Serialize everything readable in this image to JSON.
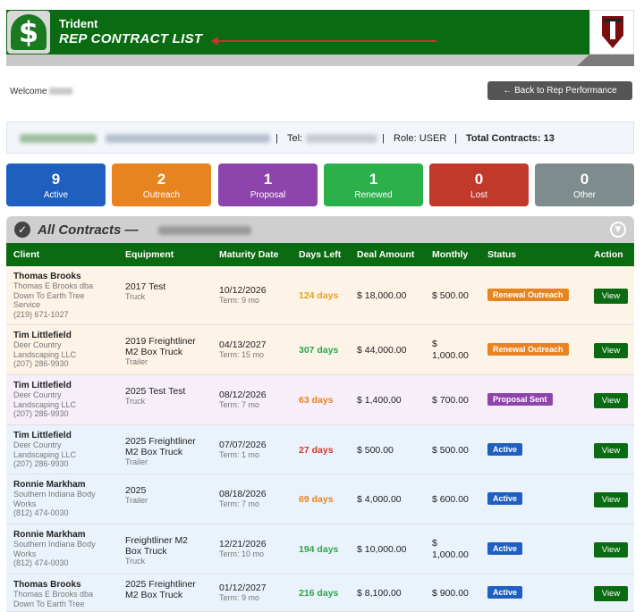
{
  "header": {
    "brand": "Trident",
    "title": "REP CONTRACT LIST"
  },
  "welcome_label": "Welcome",
  "back_button_label": "← Back to Rep Performance",
  "info": {
    "tel_label": "Tel:",
    "sep1": "|",
    "sep2": "|",
    "sep3": "|",
    "role": "Role: USER",
    "total_label": "Total Contracts: 13"
  },
  "stats": [
    {
      "count": "9",
      "label": "Active",
      "color": "#1f5fbf"
    },
    {
      "count": "2",
      "label": "Outreach",
      "color": "#e8841f"
    },
    {
      "count": "1",
      "label": "Proposal",
      "color": "#8e44ad"
    },
    {
      "count": "1",
      "label": "Renewed",
      "color": "#2bb04a"
    },
    {
      "count": "0",
      "label": "Lost",
      "color": "#c0392b"
    },
    {
      "count": "0",
      "label": "Other",
      "color": "#7f8c8d"
    }
  ],
  "section_title": "All Contracts —",
  "columns": [
    "Client",
    "Equipment",
    "Maturity Date",
    "Days Left",
    "Deal Amount",
    "Monthly",
    "Status",
    "Action"
  ],
  "rows": [
    {
      "name": "Thomas Brooks",
      "company1": "Thomas E Brooks dba",
      "company2": "Down To Earth Tree",
      "company3": "Service",
      "phone": "(219) 671-1027",
      "eq1": "2017 Test",
      "eq2": "",
      "eqtype": "Truck",
      "date": "10/12/2026",
      "term": "Term: 9 mo",
      "days": "124 days",
      "days_color": "#e8a11f",
      "amount": "$ 18,000.00",
      "monthly1": "$ 500.00",
      "monthly2": "",
      "status": "Renewal Outreach",
      "status_color": "#e8841f",
      "action": "View",
      "bg": "#fdf3e6"
    },
    {
      "name": "Tim Littlefield",
      "company1": "Deer Country",
      "company2": "Landscaping LLC",
      "company3": "",
      "phone": "(207) 286-9930",
      "eq1": "2019 Freightliner",
      "eq2": "M2 Box Truck",
      "eqtype": "Trailer",
      "date": "04/13/2027",
      "term": "Term: 15 mo",
      "days": "307 days",
      "days_color": "#2aa84a",
      "amount": "$ 44,000.00",
      "monthly1": "$",
      "monthly2": "1,000.00",
      "status": "Renewal Outreach",
      "status_color": "#e8841f",
      "action": "View",
      "bg": "#fdf3e6"
    },
    {
      "name": "Tim Littlefield",
      "company1": "Deer Country",
      "company2": "Landscaping LLC",
      "company3": "",
      "phone": "(207) 286-9930",
      "eq1": "2025 Test Test",
      "eq2": "",
      "eqtype": "Truck",
      "date": "08/12/2026",
      "term": "Term: 7 mo",
      "days": "63 days",
      "days_color": "#e8841f",
      "amount": "$ 1,400.00",
      "monthly1": "$ 700.00",
      "monthly2": "",
      "status": "Proposal Sent",
      "status_color": "#8e44ad",
      "action": "View",
      "bg": "#f6eef8"
    },
    {
      "name": "Tim Littlefield",
      "company1": "Deer Country",
      "company2": "Landscaping LLC",
      "company3": "",
      "phone": "(207) 286-9930",
      "eq1": "2025 Freightliner",
      "eq2": "M2 Box Truck",
      "eqtype": "Trailer",
      "date": "07/07/2026",
      "term": "Term: 1 mo",
      "days": "27 days",
      "days_color": "#d0392b",
      "amount": "$ 500.00",
      "monthly1": "$ 500.00",
      "monthly2": "",
      "status": "Active",
      "status_color": "#1f5fbf",
      "action": "View",
      "bg": "#eaf3fb"
    },
    {
      "name": "Ronnie Markham",
      "company1": "Southern Indiana Body",
      "company2": "Works",
      "company3": "",
      "phone": "(812) 474-0030",
      "eq1": "2025",
      "eq2": "",
      "eqtype": "Trailer",
      "date": "08/18/2026",
      "term": "Term: 7 mo",
      "days": "69 days",
      "days_color": "#e8841f",
      "amount": "$ 4,000.00",
      "monthly1": "$ 600.00",
      "monthly2": "",
      "status": "Active",
      "status_color": "#1f5fbf",
      "action": "View",
      "bg": "#eaf3fb"
    },
    {
      "name": "Ronnie Markham",
      "company1": "Southern Indiana Body",
      "company2": "Works",
      "company3": "",
      "phone": "(812) 474-0030",
      "eq1": "Freightliner M2",
      "eq2": "Box Truck",
      "eqtype": "Truck",
      "date": "12/21/2026",
      "term": "Term: 10 mo",
      "days": "194 days",
      "days_color": "#2aa84a",
      "amount": "$ 10,000.00",
      "monthly1": "$",
      "monthly2": "1,000.00",
      "status": "Active",
      "status_color": "#1f5fbf",
      "action": "View",
      "bg": "#eaf3fb"
    },
    {
      "name": "Thomas Brooks",
      "company1": "Thomas E Brooks dba",
      "company2": "Down To Earth Tree",
      "company3": "",
      "phone": "",
      "eq1": "2025 Freightliner",
      "eq2": "M2 Box Truck",
      "eqtype": "",
      "date": "01/12/2027",
      "term": "Term: 9 mo",
      "days": "216 days",
      "days_color": "#2aa84a",
      "amount": "$ 8,100.00",
      "monthly1": "$ 900.00",
      "monthly2": "",
      "status": "Active",
      "status_color": "#1f5fbf",
      "action": "View",
      "bg": "#eaf3fb"
    }
  ]
}
